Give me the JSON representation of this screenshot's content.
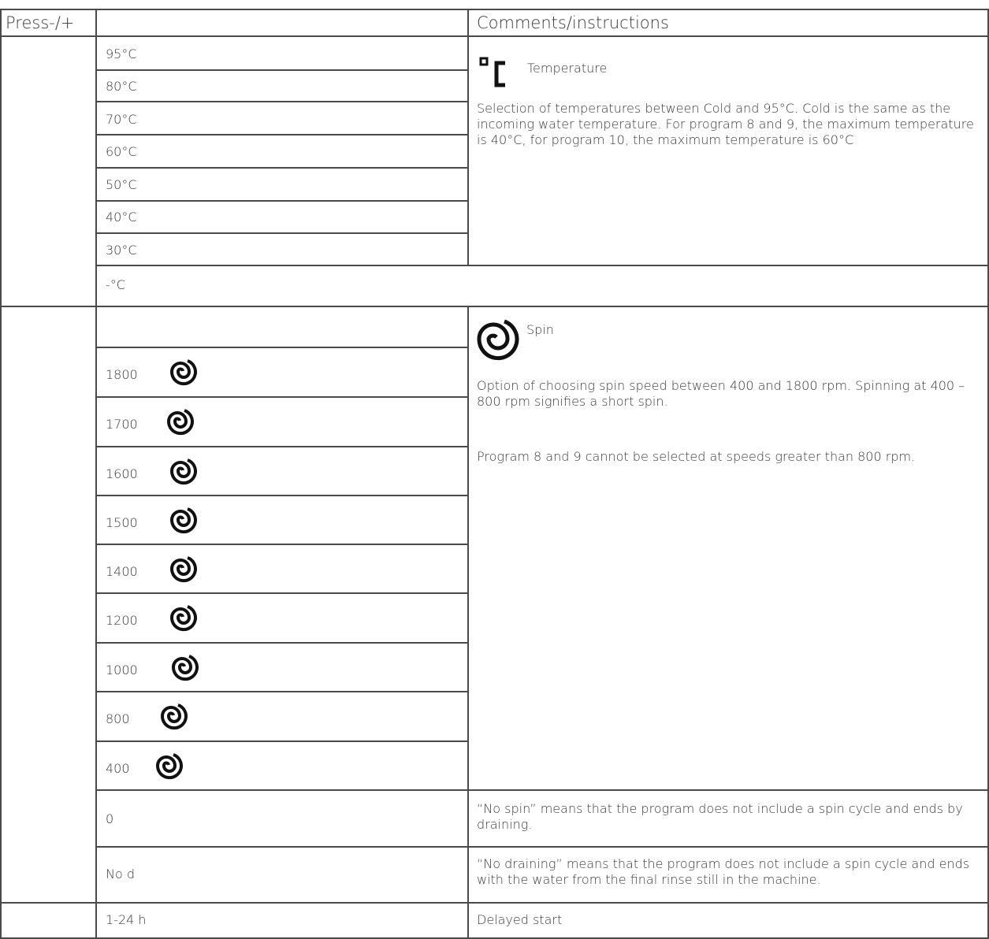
{
  "header": {
    "col1": "Press-/+",
    "col2": "",
    "col3": "Comments/instructions"
  },
  "temperature": {
    "options": [
      "95°C",
      "80°C",
      "70°C",
      "60°C",
      "50°C",
      "40°C",
      "30°C"
    ],
    "cold_label": "-°C",
    "title": "Temperature",
    "description": "Selection of temperatures between Cold and 95°C. Cold is the same as the incoming water temperature. For program 8 and 9, the maximum temperature is 40°C, for program 10, the maximum temperature is 60°C"
  },
  "spin": {
    "title": "Spin",
    "speeds": [
      "1800",
      "1700",
      "1600",
      "1500",
      "1400",
      "1200",
      "1000",
      "800",
      "400"
    ],
    "description1": "Option of choosing spin speed between 400 and 1800 rpm. Spinning at 400 – 800 rpm signifies a short spin.",
    "description2": "Program 8 and 9 cannot be selected at speeds greater than 800 rpm.",
    "no_spin_value": "0",
    "no_spin_text": "“No spin” means that the program does not include a spin cycle and ends by draining.",
    "no_drain_value": "No d",
    "no_drain_text": "“No draining” means that the program does not include a spin cycle and ends with the water from the final rinse still in the machine.",
    "icon": "spin-spiral-icon"
  },
  "delay": {
    "value": "1-24 h",
    "text": "Delayed start"
  }
}
